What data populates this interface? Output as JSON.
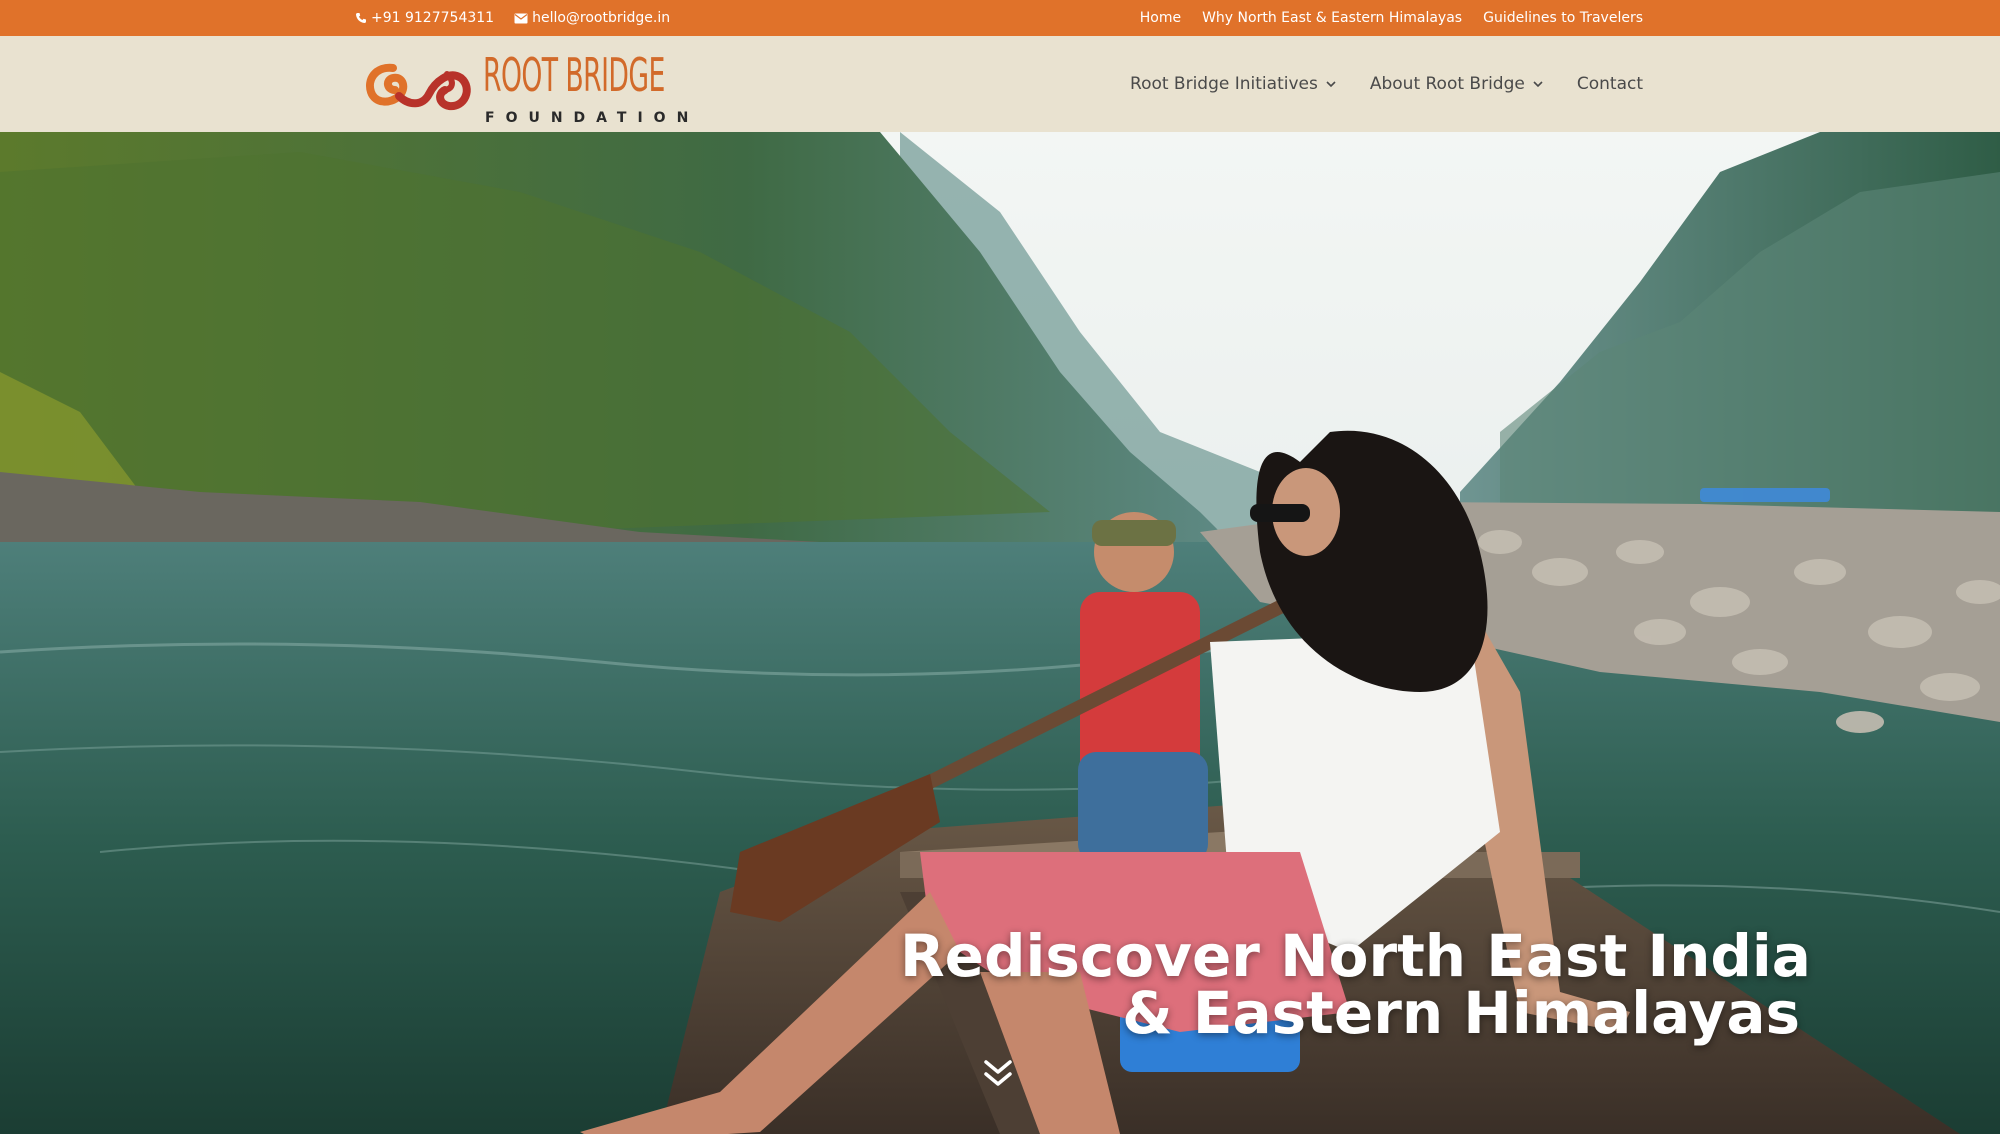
{
  "topbar": {
    "phone": "+91 9127754311",
    "email": "hello@rootbridge.in",
    "nav": [
      "Home",
      "Why North East & Eastern Himalayas",
      "Guidelines to Travelers"
    ]
  },
  "header": {
    "logo_text": "ROOT BRIDGE",
    "logo_subtext": "FOUNDATION",
    "nav": [
      {
        "label": "Root Bridge Initiatives",
        "has_dropdown": true
      },
      {
        "label": "About Root Bridge",
        "has_dropdown": true
      },
      {
        "label": "Contact",
        "has_dropdown": false
      }
    ]
  },
  "hero": {
    "title_line1": "Rediscover North East India",
    "title_line2": "& Eastern Himalayas",
    "scroll_icon": "double-chevron-down-icon"
  },
  "colors": {
    "topbar": "#e0722a",
    "header_bg": "#e9e2d0",
    "logo_orange": "#d26a2a",
    "logo_red": "#b8322a",
    "nav_text": "#4a4a4a"
  }
}
